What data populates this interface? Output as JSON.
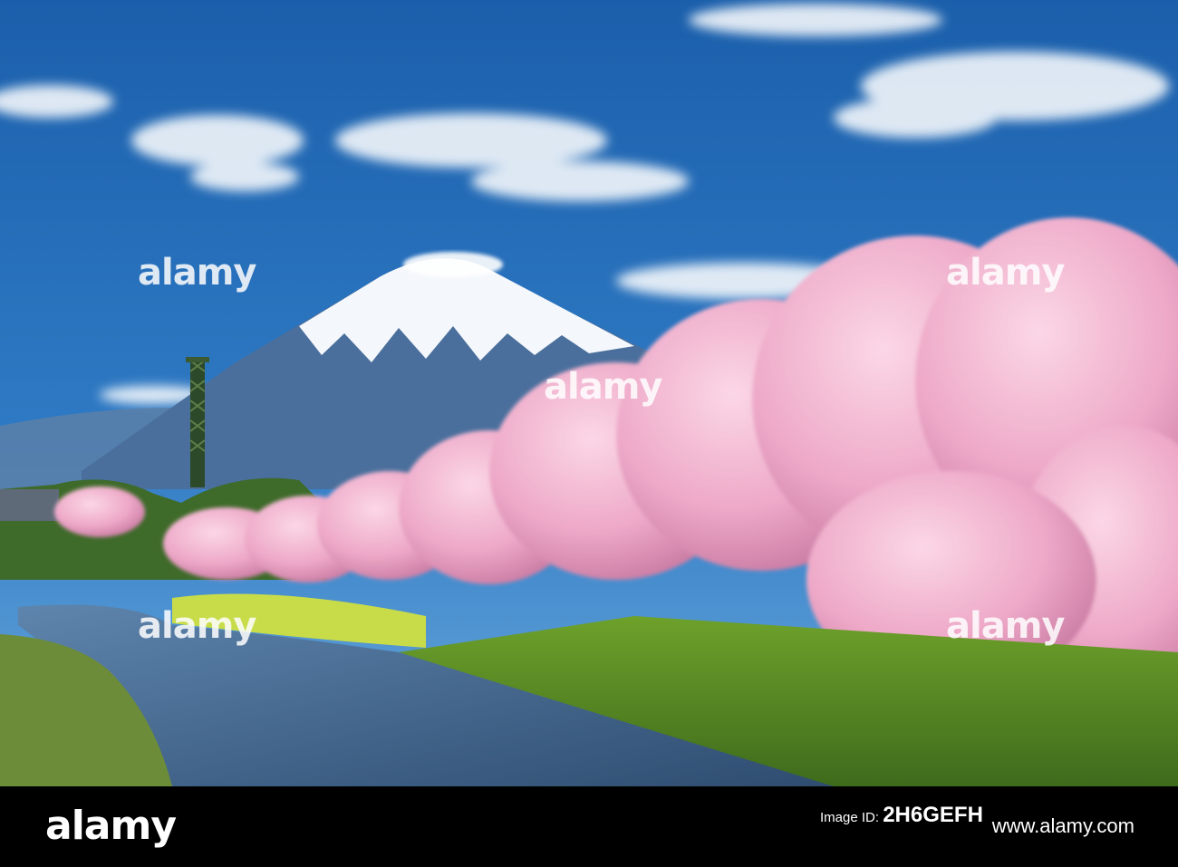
{
  "image": {
    "description_free": true,
    "watermark": {
      "text": "alamy"
    },
    "colors": {
      "sky_top": "#1b5fab",
      "sky_bottom": "#5fa3da",
      "snow": "#f4f7fb",
      "mountain": "#4a6f9c",
      "blossom": "#f2b7cf",
      "blossom_shade": "#d27da6",
      "grass": "#5c8f25",
      "river": "#3d5f86"
    }
  },
  "stock_bar": {
    "logo": "alamy",
    "id_label": "Image ID:",
    "id_value": "2H6GEFH",
    "site": "www.alamy.com"
  }
}
